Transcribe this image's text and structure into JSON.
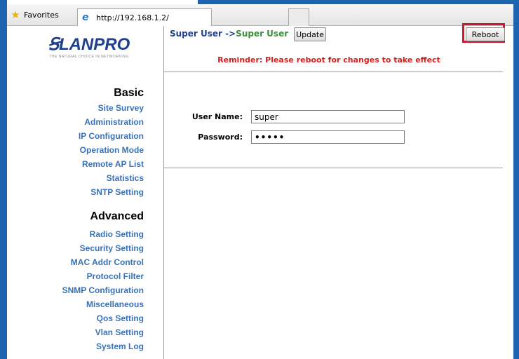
{
  "browser": {
    "favorites_label": "Favorites",
    "tab_url": "http://192.168.1.2/",
    "star_icon": "star-icon",
    "ie_icon": "ie-icon"
  },
  "logo": {
    "text": "LANPRO",
    "tagline": "THE NATURAL CHOICE IN NETWORKING",
    "color": "#1f3f8f"
  },
  "sidebar": {
    "basic_title": "Basic",
    "basic_items": [
      "Site Survey",
      "Administration",
      "IP Configuration",
      "Operation Mode",
      "Remote AP List",
      "Statistics",
      "SNTP Setting"
    ],
    "advanced_title": "Advanced",
    "advanced_items": [
      "Radio Setting",
      "Security Setting",
      "MAC Addr Control",
      "Protocol Filter",
      "SNMP Configuration",
      "Miscellaneous",
      "Qos Setting",
      "Vlan Setting",
      "System Log"
    ],
    "link_color": "#3a72b8"
  },
  "main": {
    "user_prefix": "Super User ->",
    "user_current": "Super User",
    "update_label": "Update",
    "reboot_label": "Reboot",
    "reminder": "Reminder: Please reboot for changes to take effect",
    "username_label": "User Name:",
    "username_value": "super",
    "password_label": "Password:",
    "password_value": "•••••",
    "reminder_color": "#d61d1d",
    "highlight_color": "#d8142c"
  }
}
